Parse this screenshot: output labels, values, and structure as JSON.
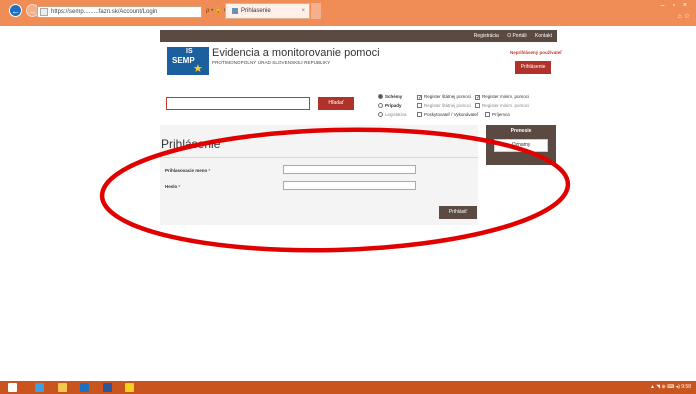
{
  "browser": {
    "url": "https://semp.........fazn.sk/Account/Login",
    "address_controls": "ρ • 🔒 C",
    "tab_label": "Prihlasenie",
    "tab_close": "×",
    "window_controls": "– ▫ ×",
    "home_icons": "⌂ ☆",
    "back_arrow": "←",
    "forward_arrow": "→"
  },
  "site": {
    "topnav": [
      "Registrácia",
      "O Portáli",
      "Kontakt"
    ],
    "logo_top": "IS",
    "logo_main": "SEMP",
    "logo_star": "★",
    "title": "Evidencia a monitorovanie pomoci",
    "subtitle": "PROTIMONOPOLNÝ ÚRAD SLOVENSKEJ REPUBLIKY",
    "user_status": "Neprihlásený používateľ",
    "login_button": "Prihlásenie"
  },
  "search": {
    "value": "",
    "button_label": "Hľadať",
    "radios": [
      {
        "label": "Schémy",
        "checked": true
      },
      {
        "label": "Prípady",
        "checked": false
      },
      {
        "label": "Legislatíva",
        "checked": false
      }
    ],
    "checks": [
      {
        "label": "Register štátnej pomoci",
        "checked": true
      },
      {
        "label": "Register štátnej pomoci",
        "checked": false
      },
      {
        "label": "Poskytovateľ / Vykonávateľ",
        "checked": false
      },
      {
        "label": "Register minim. pomoci",
        "checked": true
      },
      {
        "label": "Register minim. pomoci",
        "checked": false
      },
      {
        "label": "Príjemca",
        "checked": false
      }
    ]
  },
  "login": {
    "heading": "Prihlásenie",
    "username_label": "Prihlasovacie meno",
    "password_label": "Heslo",
    "required_marker": "*",
    "username_value": "",
    "password_value": "",
    "submit_label": "Prihlásiť"
  },
  "side_panel": {
    "title": "Prenesie",
    "button_label": "Oznamy"
  },
  "taskbar": {
    "tray_text": "▲ ◥ ⊕ ⌨ ◂)  9:58"
  },
  "colors": {
    "browser_chrome": "#f08c55",
    "site_dark": "#5a4a42",
    "brand_red": "#b1322a",
    "annotation_red": "#e00000",
    "taskbar": "#c9541e"
  }
}
